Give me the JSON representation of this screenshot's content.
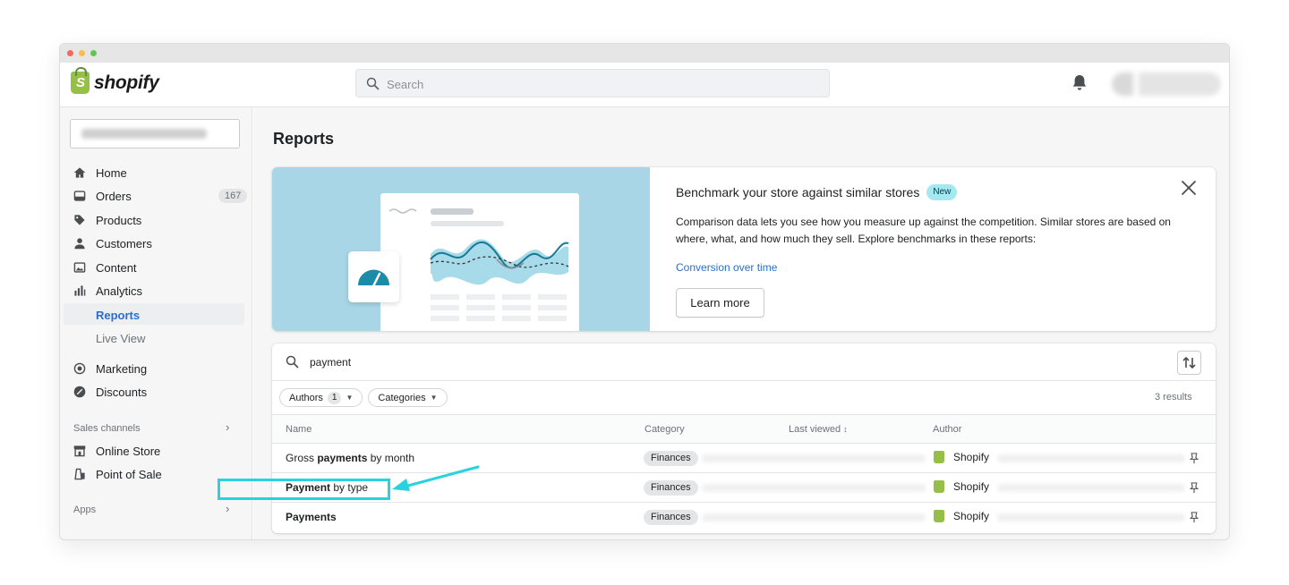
{
  "app": {
    "brand": "shopify",
    "search_placeholder": "Search"
  },
  "sidebar": {
    "items": [
      {
        "label": "Home",
        "icon": "home-icon"
      },
      {
        "label": "Orders",
        "icon": "orders-icon",
        "badge": "167"
      },
      {
        "label": "Products",
        "icon": "tag-icon"
      },
      {
        "label": "Customers",
        "icon": "person-icon"
      },
      {
        "label": "Content",
        "icon": "image-icon"
      },
      {
        "label": "Analytics",
        "icon": "bar-chart-icon"
      }
    ],
    "analytics_sub": [
      {
        "label": "Reports",
        "active": true
      },
      {
        "label": "Live View",
        "active": false
      }
    ],
    "items2": [
      {
        "label": "Marketing",
        "icon": "target-icon"
      },
      {
        "label": "Discounts",
        "icon": "discount-icon"
      }
    ],
    "sales_channels_label": "Sales channels",
    "sales_channels": [
      {
        "label": "Online Store",
        "icon": "store-icon"
      },
      {
        "label": "Point of Sale",
        "icon": "pos-icon"
      }
    ],
    "apps_label": "Apps"
  },
  "page": {
    "title": "Reports"
  },
  "banner": {
    "title": "Benchmark your store against similar stores",
    "badge": "New",
    "description": "Comparison data lets you see how you measure up against the competition. Similar stores are based on where, what, and how much they sell. Explore benchmarks in these reports:",
    "link": "Conversion over time",
    "button": "Learn more"
  },
  "reports": {
    "filter_value": "payment",
    "chips": [
      {
        "label": "Authors",
        "count": "1"
      },
      {
        "label": "Categories"
      }
    ],
    "results": "3 results",
    "columns": [
      "Name",
      "Category",
      "Last viewed",
      "Author"
    ],
    "rows": [
      {
        "name_bold": "",
        "name_plain": "Gross ",
        "name_bold2": "payments",
        "name_plain2": " by month",
        "category": "Finances",
        "author": "Shopify"
      },
      {
        "name_bold": "Payment",
        "name_plain": " by type",
        "name_bold2": "",
        "name_plain2": "",
        "category": "Finances",
        "author": "Shopify"
      },
      {
        "name_bold": "Payments",
        "name_plain": "",
        "name_bold2": "",
        "name_plain2": "",
        "category": "Finances",
        "author": "Shopify"
      }
    ]
  },
  "colors": {
    "accent": "#2c6ecb",
    "brand_green": "#95bf47",
    "highlight": "#27d3de",
    "banner_bg": "#a9d6e6"
  }
}
